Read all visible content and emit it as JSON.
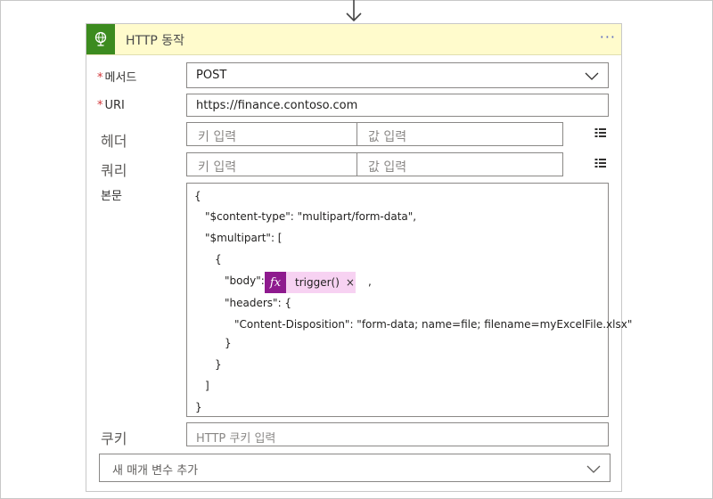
{
  "action": {
    "title": "HTTP 동작",
    "more": "···"
  },
  "method": {
    "label": "메서드",
    "required_mark": "*",
    "value": "POST"
  },
  "uri": {
    "label": "URI",
    "required_mark": "*",
    "value": "https://finance.contoso.com"
  },
  "headers": {
    "label": "헤더",
    "key_placeholder": "키 입력",
    "value_placeholder": "값 입력"
  },
  "queries": {
    "label": "쿼리",
    "key_placeholder": "키 입력",
    "value_placeholder": "값 입력"
  },
  "body": {
    "label": "본문",
    "lines": [
      "{",
      "\"$content-type\": \"multipart/form-data\",",
      "\"$multipart\": [",
      "{",
      "\"body\":",
      "\"headers\": {",
      "\"Content-Disposition\": \"form-data; name=file; filename=myExcelFile.xlsx\"",
      "}",
      "}",
      "]",
      "}"
    ],
    "token": {
      "fx": "fx",
      "text": "trigger()",
      "close": "×",
      "after": ","
    }
  },
  "cookie": {
    "label": "쿠키",
    "placeholder": "HTTP 쿠키 입력"
  },
  "add_parameter": {
    "placeholder": "새 매개 변수 추가"
  },
  "colors": {
    "header_bg": "#fffbcc",
    "icon_bg": "#3c8b1f",
    "token_bg": "#f7d2f2",
    "token_fx_bg": "#8e1a8e",
    "required": "#d13438"
  }
}
